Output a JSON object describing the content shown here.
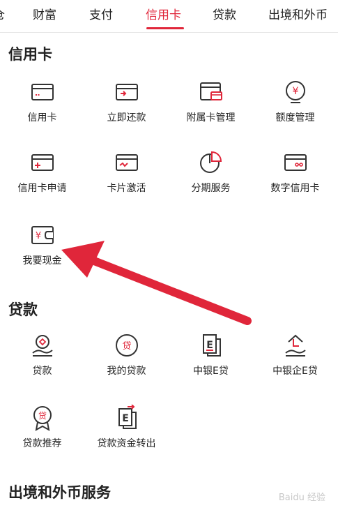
{
  "tabs": [
    {
      "label": "仓"
    },
    {
      "label": "财富"
    },
    {
      "label": "支付"
    },
    {
      "label": "信用卡"
    },
    {
      "label": "贷款"
    },
    {
      "label": "出境和外币"
    }
  ],
  "active_tab": "信用卡",
  "accent_color": "#e0263a",
  "sections": {
    "credit": {
      "title": "信用卡",
      "items": [
        {
          "label": "信用卡",
          "icon": "credit-card-icon"
        },
        {
          "label": "立即还款",
          "icon": "repay-card-icon"
        },
        {
          "label": "附属卡管理",
          "icon": "sub-card-icon"
        },
        {
          "label": "额度管理",
          "icon": "yen-circle-icon"
        },
        {
          "label": "信用卡申请",
          "icon": "card-apply-icon"
        },
        {
          "label": "卡片激活",
          "icon": "card-activate-icon"
        },
        {
          "label": "分期服务",
          "icon": "pie-chart-icon"
        },
        {
          "label": "数字信用卡",
          "icon": "digital-card-icon"
        },
        {
          "label": "我要现金",
          "icon": "cash-wallet-icon"
        }
      ]
    },
    "loan": {
      "title": "贷款",
      "items": [
        {
          "label": "贷款",
          "icon": "loan-hand-icon"
        },
        {
          "label": "我的贷款",
          "icon": "loan-circle-icon"
        },
        {
          "label": "中银E贷",
          "icon": "e-loan-icon"
        },
        {
          "label": "中银企E贷",
          "icon": "business-loan-icon"
        },
        {
          "label": "贷款推荐",
          "icon": "loan-badge-icon"
        },
        {
          "label": "贷款资金转出",
          "icon": "loan-transfer-icon"
        }
      ]
    },
    "forex": {
      "title": "出境和外币服务"
    }
  },
  "watermark": "Baidu 经验"
}
